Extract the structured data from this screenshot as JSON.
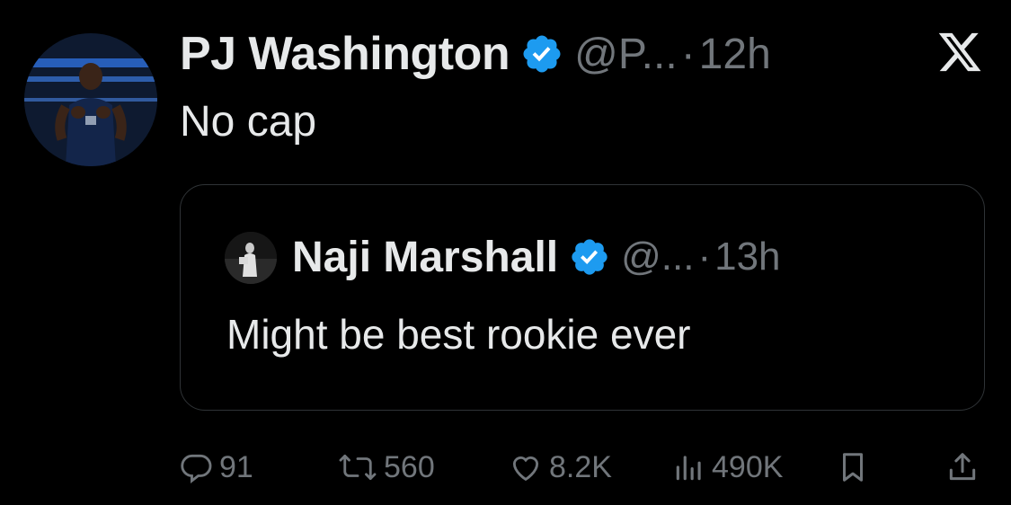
{
  "tweet": {
    "author_name": "PJ Washington",
    "handle": "@P...",
    "separator": "·",
    "time": "12h",
    "text": "No cap"
  },
  "quoted_tweet": {
    "author_name": "Naji Marshall",
    "handle": "@...",
    "separator": "·",
    "time": "13h",
    "text": "Might be best rookie ever"
  },
  "actions": {
    "replies": "91",
    "reposts": "560",
    "likes": "8.2K",
    "views": "490K"
  },
  "icons": [
    "verified-badge-icon",
    "x-logo-icon",
    "reply-icon",
    "repost-icon",
    "like-icon",
    "views-icon",
    "bookmark-icon",
    "share-icon"
  ],
  "colors": {
    "background": "#000000",
    "text_primary": "#e7e9ea",
    "text_secondary": "#71767b",
    "verified_blue": "#1d9bf0",
    "border": "#2f3336"
  }
}
